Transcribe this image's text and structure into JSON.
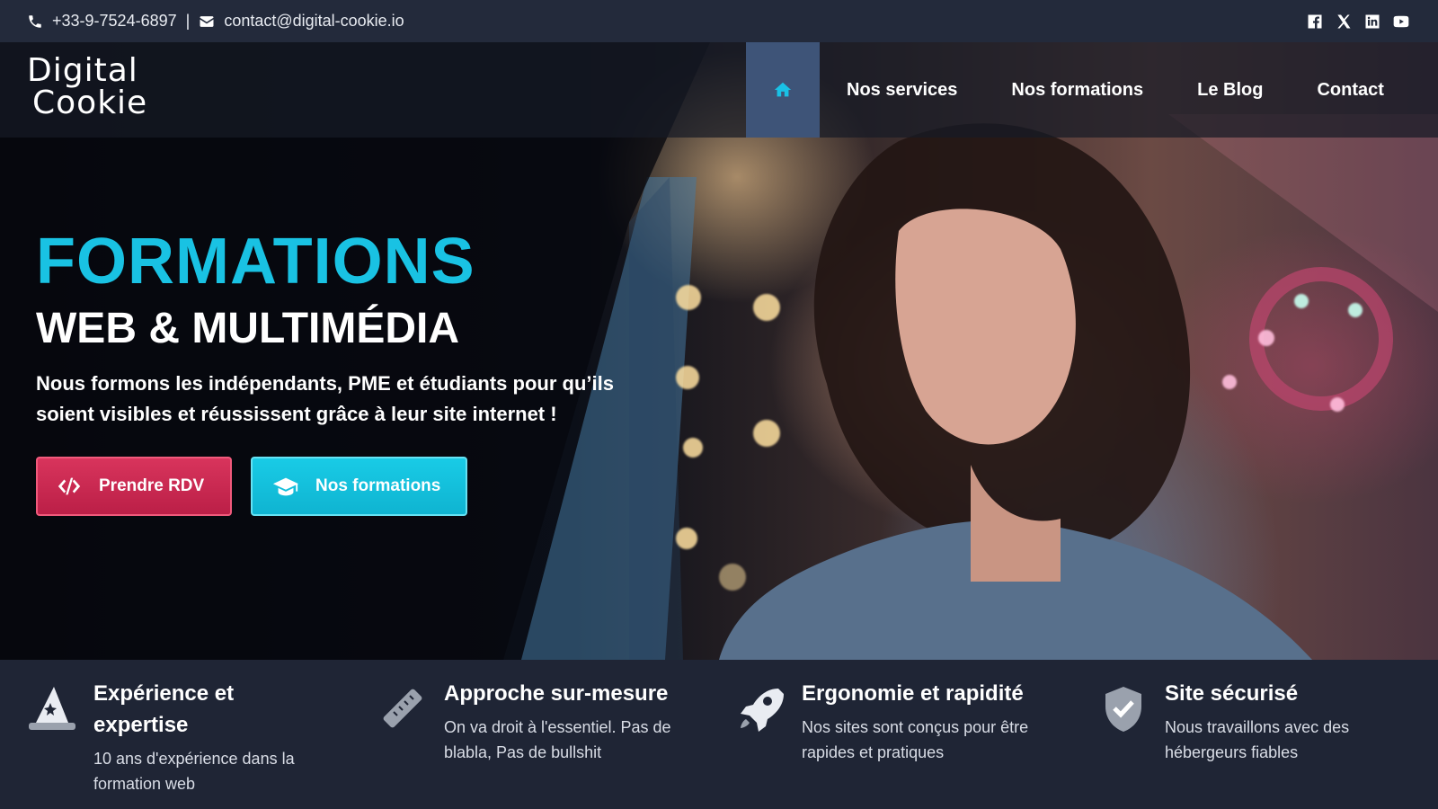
{
  "topbar": {
    "phone": "+33-9-7524-6897",
    "separator": "|",
    "email": "contact@digital-cookie.io",
    "socials": [
      "facebook-icon",
      "x-icon",
      "linkedin-icon",
      "youtube-icon"
    ]
  },
  "brand": {
    "line1": "Digital",
    "line2": "Cookie"
  },
  "nav": {
    "home_icon": "home-icon",
    "items": [
      "Nos services",
      "Nos formations",
      "Le Blog",
      "Contact"
    ]
  },
  "hero": {
    "title": "FORMATIONS",
    "subtitle": "WEB & MULTIMÉDIA",
    "lead": "Nous formons les indépendants, PME et étudiants pour qu’ils soient visibles et réussissent grâce à leur site internet !",
    "cta_primary": "Prendre RDV",
    "cta_secondary": "Nos formations"
  },
  "features": [
    {
      "icon": "wizard-hat-icon",
      "title": "Expérience et expertise",
      "desc": "10 ans d'expérience dans la formation web"
    },
    {
      "icon": "ruler-icon",
      "title": "Approche sur-mesure",
      "desc": "On va droit à l'essentiel. Pas de blabla, Pas de bullshit"
    },
    {
      "icon": "rocket-icon",
      "title": "Ergonomie et rapidité",
      "desc": "Nos sites sont conçus pour être rapides et pratiques"
    },
    {
      "icon": "shield-check-icon",
      "title": "Site sécurisé",
      "desc": "Nous travaillons avec des hébergeurs fiables"
    }
  ],
  "colors": {
    "accent_cyan": "#19c2e3",
    "accent_red": "#d02f57",
    "nav_home_bg": "#3e5478",
    "dark_bg": "#1f2535"
  }
}
